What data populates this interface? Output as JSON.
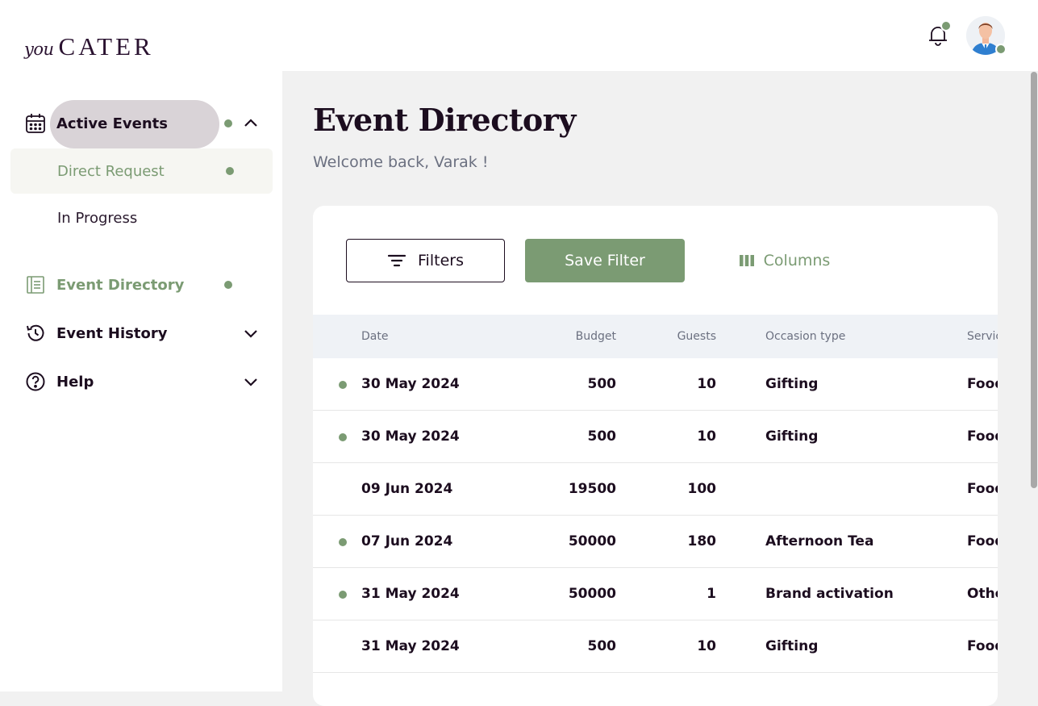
{
  "brand": {
    "prefix": "you",
    "name": "CATER"
  },
  "sidebar": {
    "items": [
      {
        "label": "Active Events",
        "icon": "calendar-icon",
        "has_dot": true,
        "chevron": "chevron-up-icon"
      },
      {
        "label": "Event Directory",
        "icon": "directory-icon",
        "has_dot": true,
        "color": "#7b9b73"
      },
      {
        "label": "Event History",
        "icon": "history-icon",
        "chevron": "chevron-down-icon"
      },
      {
        "label": "Help",
        "icon": "help-icon",
        "chevron": "chevron-down-icon"
      }
    ],
    "sub_items": [
      {
        "label": "Direct Request",
        "selected": true,
        "has_dot": true
      },
      {
        "label": "In Progress"
      }
    ]
  },
  "header": {
    "title": "Event Directory",
    "subtitle": "Welcome back, Varak !"
  },
  "toolbar": {
    "filters_label": "Filters",
    "save_filter_label": "Save Filter",
    "columns_label": "Columns"
  },
  "table": {
    "columns": [
      "Date",
      "Budget",
      "Guests",
      "Occasion type",
      "Servic"
    ],
    "rows": [
      {
        "unread": true,
        "date": "30 May 2024",
        "budget": "500",
        "guests": "10",
        "occasion": "Gifting",
        "service": "Food"
      },
      {
        "unread": true,
        "date": "30 May 2024",
        "budget": "500",
        "guests": "10",
        "occasion": "Gifting",
        "service": "Food"
      },
      {
        "unread": false,
        "date": "09 Jun 2024",
        "budget": "19500",
        "guests": "100",
        "occasion": "",
        "service": "Food"
      },
      {
        "unread": true,
        "date": "07 Jun 2024",
        "budget": "50000",
        "guests": "180",
        "occasion": "Afternoon Tea",
        "service": "Food"
      },
      {
        "unread": true,
        "date": "31 May 2024",
        "budget": "50000",
        "guests": "1",
        "occasion": "Brand activation",
        "service": "Othe"
      },
      {
        "unread": false,
        "date": "31 May 2024",
        "budget": "500",
        "guests": "10",
        "occasion": "Gifting",
        "service": "Food"
      }
    ]
  },
  "colors": {
    "accent": "#7b9b73",
    "text": "#1c0d1f",
    "muted": "#6b7080"
  }
}
